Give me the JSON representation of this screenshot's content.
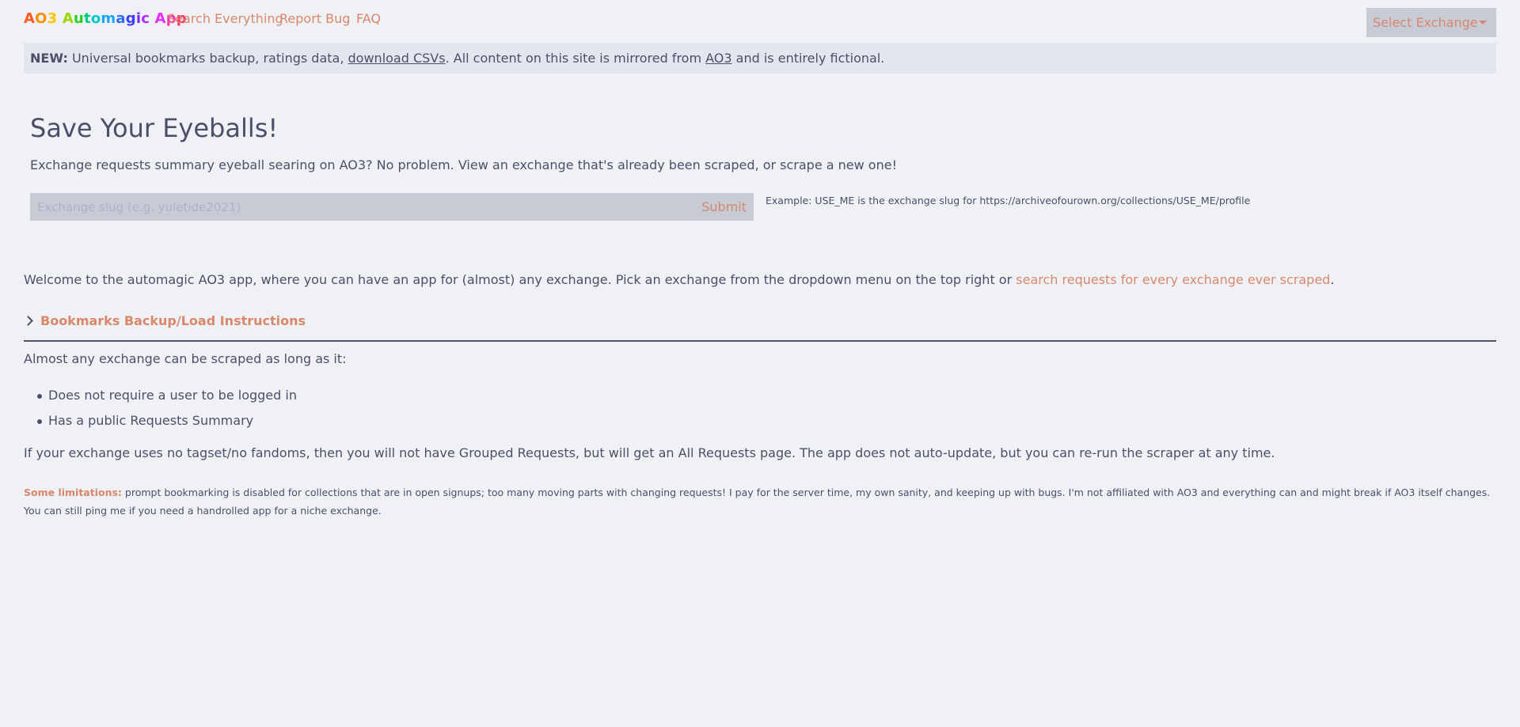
{
  "brand": {
    "letters": [
      {
        "char": "A",
        "color": "#ff5a1f"
      },
      {
        "char": "O",
        "color": "#ff8f00"
      },
      {
        "char": "3",
        "color": "#ffc400"
      },
      {
        "char": " ",
        "color": "#ffffff"
      },
      {
        "char": "A",
        "color": "#9cd600"
      },
      {
        "char": "u",
        "color": "#26d01f"
      },
      {
        "char": "t",
        "color": "#00c78a"
      },
      {
        "char": "o",
        "color": "#00c8c8"
      },
      {
        "char": "m",
        "color": "#1aa6ff"
      },
      {
        "char": "a",
        "color": "#2e6bff"
      },
      {
        "char": "g",
        "color": "#3d3bff"
      },
      {
        "char": "i",
        "color": "#7a2cff"
      },
      {
        "char": "c",
        "color": "#b12cff"
      },
      {
        "char": " ",
        "color": "#ffffff"
      },
      {
        "char": "A",
        "color": "#e82cff"
      },
      {
        "char": "p",
        "color": "#ff2cb2"
      },
      {
        "char": "p",
        "color": "#ff2c6b"
      }
    ]
  },
  "nav": {
    "search": "Search Everything",
    "report": "Report Bug",
    "faq": "FAQ",
    "select_exchange": "Select Exchange"
  },
  "notice": {
    "label": "NEW:",
    "text_1": " Universal bookmarks backup, ratings data, ",
    "csv_link": "download CSVs",
    "text_2": ". All content on this site is mirrored from ",
    "ao3_link": "AO3",
    "text_3": " and is entirely fictional."
  },
  "hero": {
    "title": "Save Your Eyeballs!",
    "description": "Exchange requests summary eyeball searing on AO3? No problem. View an exchange that's already been scraped, or scrape a new one!",
    "placeholder": "Exchange slug (e.g. yuletide2021)",
    "submit": "Submit",
    "example": "Example: USE_ME is the exchange slug for https://archiveofourown.org/collections/USE_ME/profile"
  },
  "welcome": {
    "text": "Welcome to the automagic AO3 app, where you can have an app for (almost) any exchange. Pick an exchange from the dropdown menu on the top right or ",
    "link": "search requests for every exchange ever scraped",
    "end": "."
  },
  "bookmarks": {
    "label": "Bookmarks Backup/Load Instructions"
  },
  "scrape": {
    "intro": "Almost any exchange can be scraped as long as it:",
    "criteria": [
      "Does not require a user to be logged in",
      "Has a public Requests Summary"
    ],
    "tagset": "If your exchange uses no tagset/no fandoms, then you will not have Grouped Requests, but will get an All Requests page. The app does not auto-update, but you can re-run the scraper at any time."
  },
  "limits": {
    "label": "Some limitations:",
    "text": " prompt bookmarking is disabled for collections that are in open signups; too many moving parts with changing requests! I pay for the server time, my own sanity, and keeping up with bugs. I'm not affiliated with AO3 and everything can and might break if AO3 itself changes. You can still ping me if you need a handrolled app for a niche exchange."
  }
}
